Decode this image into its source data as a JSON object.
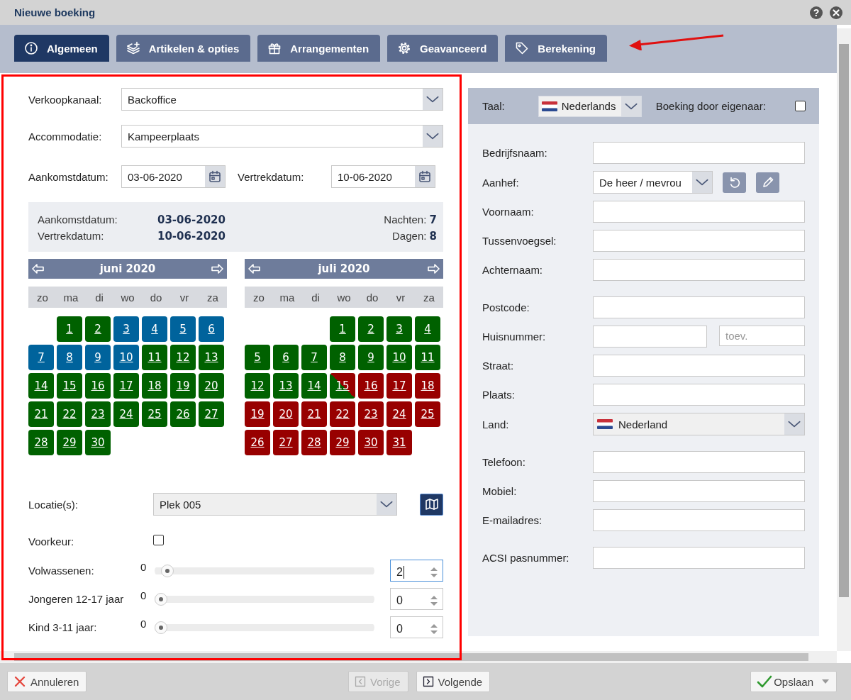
{
  "window": {
    "title": "Nieuwe boeking",
    "help": "?"
  },
  "tabs": [
    {
      "label": "Algemeen",
      "selected": true
    },
    {
      "label": "Artikelen & opties",
      "selected": false
    },
    {
      "label": "Arrangementen",
      "selected": false
    },
    {
      "label": "Geavanceerd",
      "selected": false
    },
    {
      "label": "Berekening",
      "selected": false
    }
  ],
  "annotations": {
    "highlight_frame": true,
    "arrow": true
  },
  "booking": {
    "sales_channel": {
      "label": "Verkoopkanaal:",
      "value": "Backoffice"
    },
    "accommodation": {
      "label": "Accommodatie:",
      "value": "Kampeerplaats"
    },
    "arrival": {
      "label": "Aankomstdatum:",
      "value": "03-06-2020"
    },
    "departure": {
      "label": "Vertrekdatum:",
      "value": "10-06-2020"
    },
    "summary": {
      "arrival_label": "Aankomstdatum:",
      "arrival": "03-06-2020",
      "departure_label": "Vertrekdatum:",
      "departure": "10-06-2020",
      "nights": "Nachten: **7**",
      "days": "Dagen: **8**"
    },
    "calendars": [
      {
        "title": "juni 2020",
        "weekdays": [
          "zo",
          "ma",
          "di",
          "wo",
          "do",
          "vr",
          "za"
        ],
        "days": [
          {
            "kind": "blank"
          },
          {
            "label": "1",
            "kind": "available"
          },
          {
            "label": "2",
            "kind": "available"
          },
          {
            "label": "3",
            "kind": "selected"
          },
          {
            "label": "4",
            "kind": "selected"
          },
          {
            "label": "5",
            "kind": "selected"
          },
          {
            "label": "6",
            "kind": "selected"
          },
          {
            "label": "7",
            "kind": "selected"
          },
          {
            "label": "8",
            "kind": "selected"
          },
          {
            "label": "9",
            "kind": "selected"
          },
          {
            "label": "10",
            "kind": "selected"
          },
          {
            "label": "11",
            "kind": "available"
          },
          {
            "label": "12",
            "kind": "available"
          },
          {
            "label": "13",
            "kind": "available"
          },
          {
            "label": "14",
            "kind": "available"
          },
          {
            "label": "15",
            "kind": "available"
          },
          {
            "label": "16",
            "kind": "available"
          },
          {
            "label": "17",
            "kind": "available"
          },
          {
            "label": "18",
            "kind": "available"
          },
          {
            "label": "19",
            "kind": "available"
          },
          {
            "label": "20",
            "kind": "available"
          },
          {
            "label": "21",
            "kind": "available"
          },
          {
            "label": "22",
            "kind": "available"
          },
          {
            "label": "23",
            "kind": "available"
          },
          {
            "label": "24",
            "kind": "available"
          },
          {
            "label": "25",
            "kind": "available"
          },
          {
            "label": "26",
            "kind": "available"
          },
          {
            "label": "27",
            "kind": "available"
          },
          {
            "label": "28",
            "kind": "available"
          },
          {
            "label": "29",
            "kind": "available"
          },
          {
            "label": "30",
            "kind": "available"
          }
        ]
      },
      {
        "title": "juli 2020",
        "weekdays": [
          "zo",
          "ma",
          "di",
          "wo",
          "do",
          "vr",
          "za"
        ],
        "days": [
          {
            "kind": "blank"
          },
          {
            "kind": "blank"
          },
          {
            "kind": "blank"
          },
          {
            "label": "1",
            "kind": "available"
          },
          {
            "label": "2",
            "kind": "available"
          },
          {
            "label": "3",
            "kind": "available"
          },
          {
            "label": "4",
            "kind": "available"
          },
          {
            "label": "5",
            "kind": "available"
          },
          {
            "label": "6",
            "kind": "available"
          },
          {
            "label": "7",
            "kind": "available"
          },
          {
            "label": "8",
            "kind": "available"
          },
          {
            "label": "9",
            "kind": "available"
          },
          {
            "label": "10",
            "kind": "available"
          },
          {
            "label": "11",
            "kind": "available"
          },
          {
            "label": "12",
            "kind": "available"
          },
          {
            "label": "13",
            "kind": "available"
          },
          {
            "label": "14",
            "kind": "available"
          },
          {
            "label": "15",
            "kind": "partial"
          },
          {
            "label": "16",
            "kind": "occupied"
          },
          {
            "label": "17",
            "kind": "occupied"
          },
          {
            "label": "18",
            "kind": "occupied"
          },
          {
            "label": "19",
            "kind": "occupied"
          },
          {
            "label": "20",
            "kind": "occupied"
          },
          {
            "label": "21",
            "kind": "occupied"
          },
          {
            "label": "22",
            "kind": "occupied"
          },
          {
            "label": "23",
            "kind": "occupied"
          },
          {
            "label": "24",
            "kind": "occupied"
          },
          {
            "label": "25",
            "kind": "occupied"
          },
          {
            "label": "26",
            "kind": "occupied"
          },
          {
            "label": "27",
            "kind": "occupied"
          },
          {
            "label": "28",
            "kind": "occupied"
          },
          {
            "label": "29",
            "kind": "occupied"
          },
          {
            "label": "30",
            "kind": "occupied"
          },
          {
            "label": "31",
            "kind": "occupied"
          }
        ]
      }
    ],
    "location": {
      "label": "Locatie(s):",
      "value": "Plek 005"
    },
    "preference": {
      "label": "Voorkeur:",
      "checked": false
    },
    "guests": [
      {
        "label": "Volwassenen:",
        "min": "0",
        "level": 0.03,
        "value": "2",
        "focused": true
      },
      {
        "label": "Jongeren 12-17 jaar",
        "min": "0",
        "level": 0,
        "value": "0",
        "focused": false
      },
      {
        "label": "Kind 3-11 jaar:",
        "min": "0",
        "level": 0,
        "value": "0",
        "focused": false
      }
    ]
  },
  "customer": {
    "language": {
      "label": "Taal:",
      "value": "Nederlands"
    },
    "owner_booking": {
      "label": "Boeking door eigenaar:",
      "checked": false
    },
    "groups": [
      [
        {
          "kind": "text",
          "label": "Bedrijfsnaam:"
        },
        {
          "kind": "select",
          "label": "Aanhef:",
          "value": "De heer / mevrou"
        },
        {
          "kind": "text",
          "label": "Voornaam:"
        },
        {
          "kind": "text",
          "label": "Tussenvoegsel:"
        },
        {
          "kind": "text",
          "label": "Achternaam:"
        }
      ],
      [
        {
          "kind": "text",
          "label": "Postcode:"
        },
        {
          "kind": "split",
          "label": "Huisnummer:",
          "placeholder": "toev."
        },
        {
          "kind": "text",
          "label": "Straat:"
        },
        {
          "kind": "text",
          "label": "Plaats:"
        },
        {
          "kind": "flag-select",
          "label": "Land:",
          "value": "Nederland"
        }
      ],
      [
        {
          "kind": "text",
          "label": "Telefoon:"
        },
        {
          "kind": "text",
          "label": "Mobiel:"
        },
        {
          "kind": "text",
          "label": "E-mailadres:"
        }
      ],
      [
        {
          "kind": "text",
          "label": "ACSI pasnummer:"
        }
      ]
    ]
  },
  "footer": [
    {
      "label": "Annuleren",
      "kind": "cancel",
      "disabled": false
    },
    {
      "label": "Vorige",
      "kind": "prev",
      "disabled": true
    },
    {
      "label": "Volgende",
      "kind": "next",
      "disabled": false
    },
    {
      "label": "Opslaan",
      "kind": "save",
      "disabled": false
    }
  ]
}
